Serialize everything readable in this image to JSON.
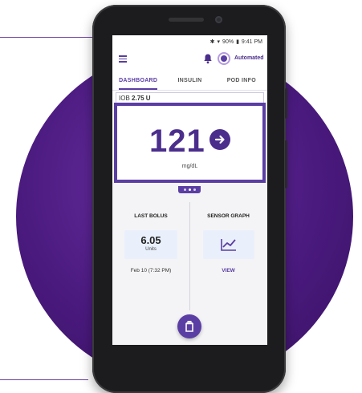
{
  "status_bar": {
    "battery": "90%",
    "time": "9:41 PM"
  },
  "app_bar": {
    "mode_label": "Automated"
  },
  "tabs": [
    {
      "label": "DASHBOARD",
      "active": true
    },
    {
      "label": "INSULIN",
      "active": false
    },
    {
      "label": "POD INFO",
      "active": false
    }
  ],
  "iob": {
    "label": "IOB",
    "value": "2.75 U"
  },
  "glucose": {
    "value": "121",
    "unit": "mg/dL",
    "trend": "arrow-right-icon"
  },
  "last_bolus": {
    "title": "LAST BOLUS",
    "value": "6.05",
    "unit": "Units",
    "date": "Feb 10 (7:32 PM)"
  },
  "sensor_graph": {
    "title": "SENSOR GRAPH",
    "link": "VIEW"
  },
  "colors": {
    "accent": "#5b3ea3",
    "background_circle": "#4a1a7e",
    "card_fill": "#eaf0fb"
  }
}
